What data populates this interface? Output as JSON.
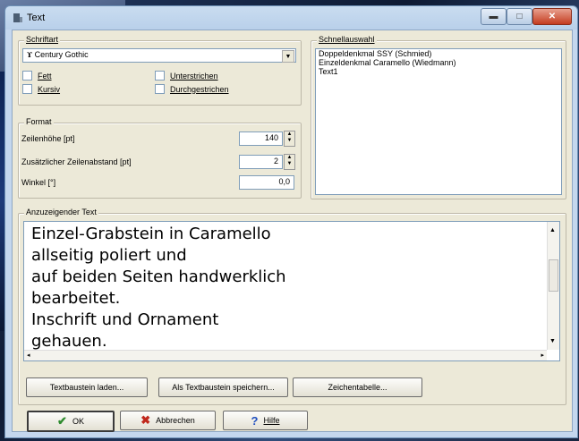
{
  "window": {
    "title": "Text"
  },
  "schriftart": {
    "legend": "Schriftart",
    "font": "Century Gothic",
    "options": {
      "fett": "Fett",
      "kursiv": "Kursiv",
      "unterstrichen": "Unterstrichen",
      "durchgestrichen": "Durchgestrichen"
    }
  },
  "schnellauswahl": {
    "legend": "Schnellauswahl",
    "items": [
      "Doppeldenkmal SSY (Schmied)",
      "Einzeldenkmal Caramello (Wiedmann)",
      "Text1"
    ]
  },
  "format": {
    "legend": "Format",
    "zeilenhoehe_label": "Zeilenhöhe [pt]",
    "zeilenhoehe_value": "140",
    "zeilenabstand_label": "Zusätzlicher Zeilenabstand [pt]",
    "zeilenabstand_value": "2",
    "winkel_label": "Winkel [°]",
    "winkel_value": "0,0"
  },
  "text": {
    "legend": "Anzuzeigender Text",
    "lines": [
      "Einzel-Grabstein in Caramello",
      "allseitig poliert und",
      "auf beiden Seiten handwerklich",
      "bearbeitet.",
      "Inschrift und Ornament",
      "gehauen."
    ]
  },
  "buttons": {
    "laden": "Textbaustein laden...",
    "speichern": "Als Textbaustein speichern...",
    "zeichentabelle": "Zeichentabelle...",
    "ok": "OK",
    "abbrechen": "Abbrechen",
    "hilfe": "Hilfe"
  },
  "colors": {
    "ok_icon": "#2e8b2e",
    "cancel_icon": "#c0281c",
    "help_icon": "#1f4fbf"
  }
}
